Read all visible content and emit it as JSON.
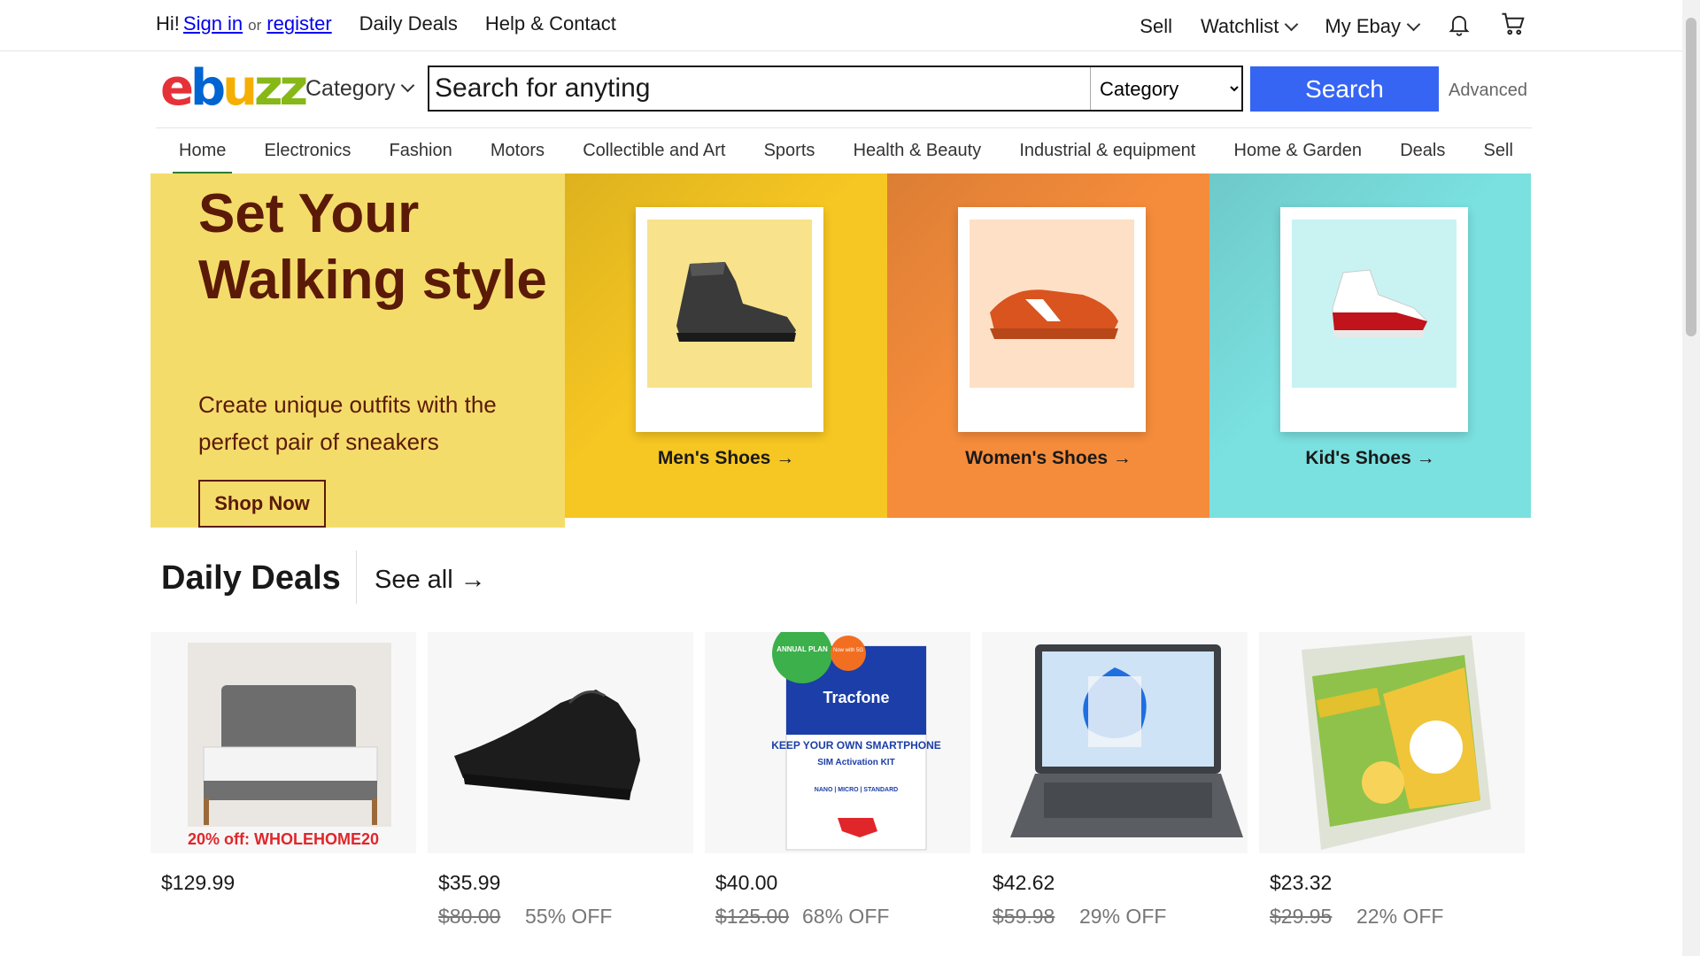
{
  "topbar": {
    "greeting": "Hi!",
    "sign_in": "Sign in",
    "or": "or",
    "register": "register",
    "daily_deals": "Daily Deals",
    "help": "Help & Contact",
    "sell": "Sell",
    "watchlist": "Watchlist",
    "my_ebay": "My Ebay"
  },
  "header": {
    "logo": [
      "e",
      "b",
      "u",
      "zz"
    ],
    "category_label": "Category",
    "search_placeholder": "Search for anyting",
    "select_value": "Category",
    "search_button": "Search",
    "advanced": "Advanced"
  },
  "nav": [
    "Home",
    "Electronics",
    "Fashion",
    "Motors",
    "Collectible and Art",
    "Sports",
    "Health & Beauty",
    "Industrial & equipment",
    "Home & Garden",
    "Deals",
    "Sell"
  ],
  "hero": {
    "title": "Set Your Walking style",
    "subtitle": "Create unique outfits with the perfect pair of sneakers",
    "cta": "Shop Now",
    "panels": [
      {
        "label": "Men's Shoes"
      },
      {
        "label": "Women's Shoes"
      },
      {
        "label": "Kid's Shoes"
      }
    ]
  },
  "daily_deals": {
    "title": "Daily Deals",
    "see_all": "See all",
    "items": [
      {
        "price": "$129.99",
        "was": "",
        "off": "",
        "promo": "20% off: WHOLEHOME20"
      },
      {
        "price": "$35.99",
        "was": "$80.00",
        "off": "55% OFF"
      },
      {
        "price": "$40.00",
        "was": "$125.00",
        "off": "68% OFF",
        "badge_top": "ANNUAL PLAN",
        "badge_5g": "Now with 5G",
        "brand": "Tracfone",
        "headline": "KEEP YOUR OWN SMARTPHONE",
        "kit": "SIM Activation KIT",
        "sizes": "NANO | MICRO | STANDARD"
      },
      {
        "price": "$42.62",
        "was": "$59.98",
        "off": "29% OFF"
      },
      {
        "price": "$23.32",
        "was": "$29.95",
        "off": "22% OFF"
      }
    ]
  }
}
